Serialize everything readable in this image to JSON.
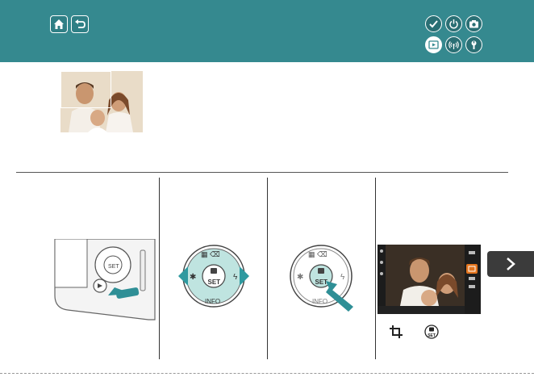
{
  "header": {
    "buttons": [
      {
        "icon": "home-icon"
      },
      {
        "icon": "back-icon"
      }
    ],
    "categories": [
      {
        "icon": "checkmark-icon",
        "active": false
      },
      {
        "icon": "power-icon",
        "active": false
      },
      {
        "icon": "camera-icon",
        "active": false
      },
      {
        "icon": "playback-icon",
        "active": true
      },
      {
        "icon": "wireless-icon",
        "active": false
      },
      {
        "icon": "wrench-icon",
        "active": false
      }
    ],
    "color": "#35898f"
  },
  "steps": [
    {
      "illustration": "camera-playback-button-press"
    },
    {
      "illustration": "control-dial-left-right"
    },
    {
      "illustration": "control-dial-set-press"
    },
    {
      "illustration": "screen-menu-crop",
      "icons": [
        "crop-icon",
        "set-button-icon"
      ]
    }
  ],
  "navigation": {
    "next": "next-page-icon"
  }
}
